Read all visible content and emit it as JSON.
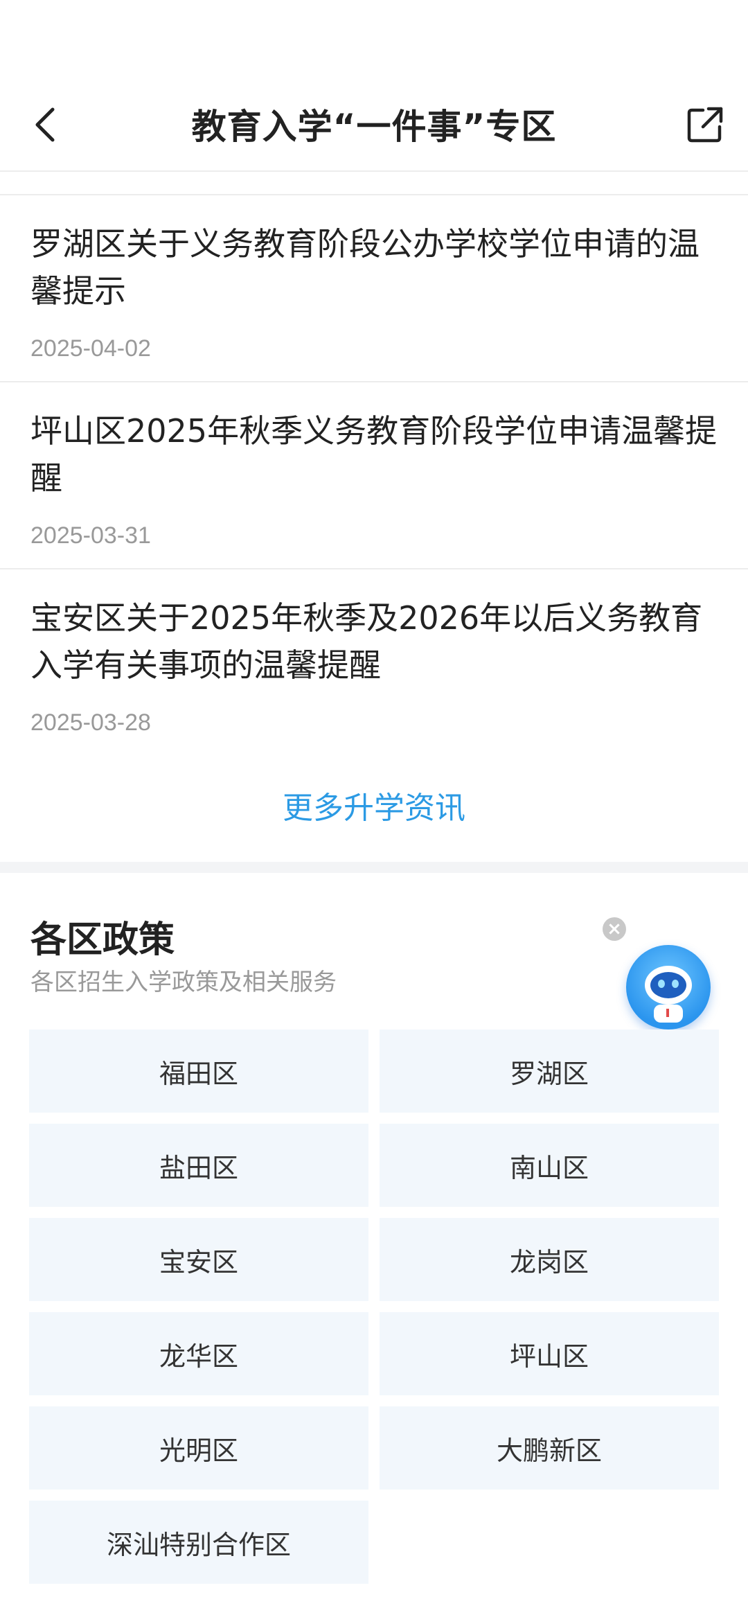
{
  "header": {
    "title": "教育入学“一件事”专区"
  },
  "news": [
    {
      "title": "罗湖区关于义务教育阶段公办学校学位申请的温馨提示",
      "date": "2025-04-02"
    },
    {
      "title": "坪山区2025年秋季义务教育阶段学位申请温馨提醒",
      "date": "2025-03-31"
    },
    {
      "title": "宝安区关于2025年秋季及2026年以后义务教育入学有关事项的温馨提醒",
      "date": "2025-03-28"
    }
  ],
  "more_link": "更多升学资讯",
  "policy": {
    "title": "各区政策",
    "subtitle": "各区招生入学政策及相关服务",
    "districts": [
      "福田区",
      "罗湖区",
      "盐田区",
      "南山区",
      "宝安区",
      "龙岗区",
      "龙华区",
      "坪山区",
      "光明区",
      "大鹏新区",
      "深汕特别合作区"
    ]
  },
  "colors": {
    "accent": "#2b9ae4",
    "district_bg": "#f2f7fc",
    "date_gray": "#999999"
  },
  "icons": {
    "back": "chevron-left-icon",
    "share": "share-icon",
    "close": "close-icon",
    "assistant": "robot-assistant-icon"
  }
}
